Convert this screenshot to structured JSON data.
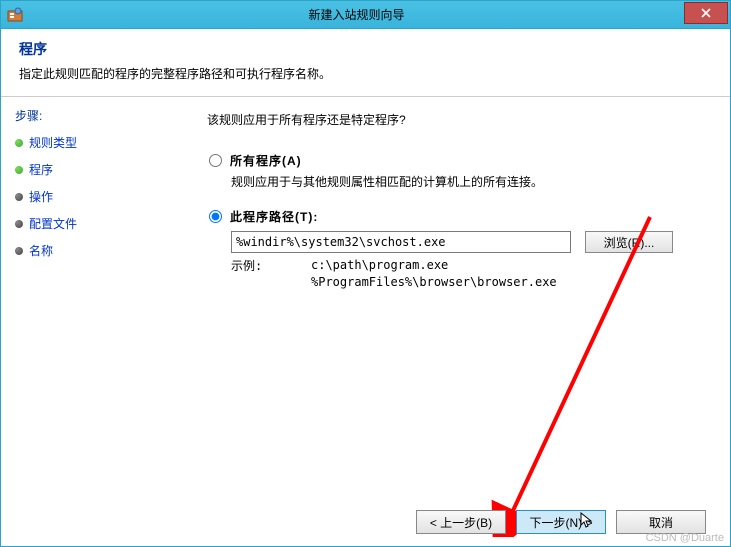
{
  "window": {
    "title": "新建入站规则向导"
  },
  "header": {
    "title": "程序",
    "description": "指定此规则匹配的程序的完整程序路径和可执行程序名称。"
  },
  "sidebar": {
    "steps_label": "步骤:",
    "items": [
      {
        "label": "规则类型",
        "state": "done"
      },
      {
        "label": "程序",
        "state": "done"
      },
      {
        "label": "操作",
        "state": "todo"
      },
      {
        "label": "配置文件",
        "state": "todo"
      },
      {
        "label": "名称",
        "state": "todo"
      }
    ]
  },
  "content": {
    "question": "该规则应用于所有程序还是特定程序?",
    "option_all": {
      "label": "所有程序(A)",
      "desc": "规则应用于与其他规则属性相匹配的计算机上的所有连接。"
    },
    "option_path": {
      "label": "此程序路径(T):"
    },
    "path_value": "%windir%\\system32\\svchost.exe",
    "browse_label": "浏览(R)...",
    "example_label": "示例:",
    "example_line1": "c:\\path\\program.exe",
    "example_line2": "%ProgramFiles%\\browser\\browser.exe"
  },
  "footer": {
    "back": "< 上一步(B)",
    "next": "下一步(N) >",
    "cancel": "取消"
  },
  "watermark": "CSDN @Duarte"
}
